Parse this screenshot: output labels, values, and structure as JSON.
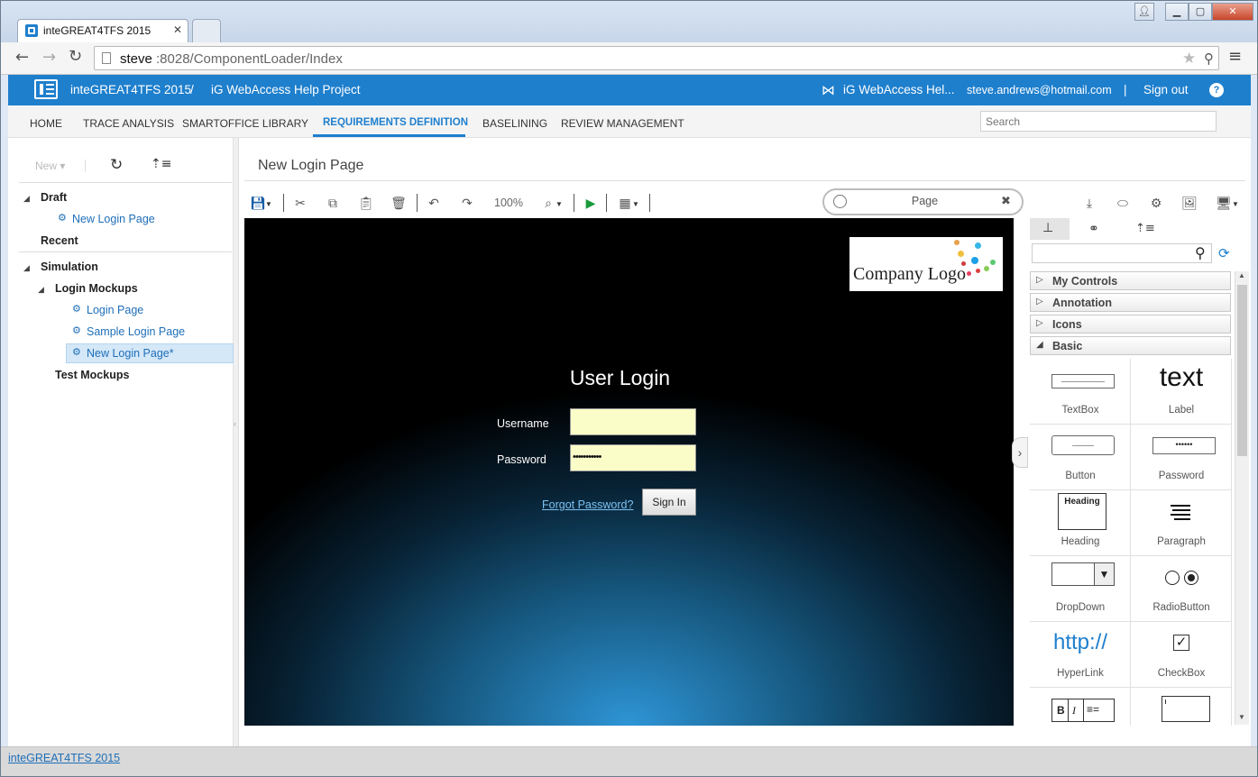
{
  "browser": {
    "tab_title": "inteGREAT4TFS 2015",
    "url_host": "steve",
    "url_path": ":8028/ComponentLoader/Index"
  },
  "header": {
    "app_name": "inteGREAT4TFS 2015",
    "separator": "/",
    "project": "iG WebAccess Help Project",
    "vs_project": "iG WebAccess Hel...",
    "user": "steve.andrews@hotmail.com",
    "divider": "|",
    "signout": "Sign out",
    "help": "?"
  },
  "menu": {
    "items": [
      "HOME",
      "TRACE ANALYSIS",
      "SMARTOFFICE LIBRARY",
      "REQUIREMENTS DEFINITION",
      "BASELINING",
      "REVIEW MANAGEMENT"
    ],
    "active": "REQUIREMENTS DEFINITION",
    "search_placeholder": "Search"
  },
  "sidebar": {
    "new_label": "New",
    "tree": {
      "draft": "Draft",
      "draft_item": "New Login Page",
      "recent": "Recent",
      "simulation": "Simulation",
      "login_mockups": "Login Mockups",
      "login_page": "Login Page",
      "sample_login_page": "Sample Login Page",
      "new_login_page_dirty": "New Login Page*",
      "test_mockups": "Test Mockups"
    }
  },
  "editor": {
    "title": "New Login Page",
    "zoom": "100%",
    "page_selector": "Page"
  },
  "canvas": {
    "logo_text": "Company Logo",
    "heading": "User Login",
    "username_label": "Username",
    "password_label": "Password",
    "password_value": "•••••••••••",
    "forgot_link": "Forgot Password?",
    "signin_button": "Sign In"
  },
  "toolbox": {
    "categories": [
      "My Controls",
      "Annotation",
      "Icons",
      "Basic"
    ],
    "controls": [
      "TextBox",
      "Label",
      "Button",
      "Password",
      "Heading",
      "Paragraph",
      "DropDown",
      "RadioButton",
      "HyperLink",
      "CheckBox"
    ],
    "label_sample": "text",
    "heading_sample": "Heading",
    "password_sample": "••••••",
    "hyperlink_sample": "http://",
    "rich_b": "B",
    "rich_i": "I"
  },
  "statusbar": {
    "link": "inteGREAT4TFS 2015"
  },
  "colors": {
    "accent": "#1e7fcd",
    "link": "#1e6fb8",
    "input_fill": "#fbfdc8"
  },
  "icons": [
    "app-logo-icon",
    "back-icon",
    "forward-icon",
    "reload-icon",
    "star-icon",
    "pin-icon",
    "menu-icon",
    "visual-studio-icon",
    "help-icon",
    "refresh-icon",
    "tree-expand-icon",
    "save-icon",
    "cut-icon",
    "copy-icon",
    "paste-icon",
    "delete-icon",
    "undo-icon",
    "redo-icon",
    "zoom-icon",
    "play-icon",
    "grid-icon",
    "download-icon",
    "lasso-icon",
    "settings-icon",
    "image-icon",
    "device-icon",
    "hierarchy-icon",
    "link-icon",
    "search-icon",
    "sync-icon"
  ]
}
